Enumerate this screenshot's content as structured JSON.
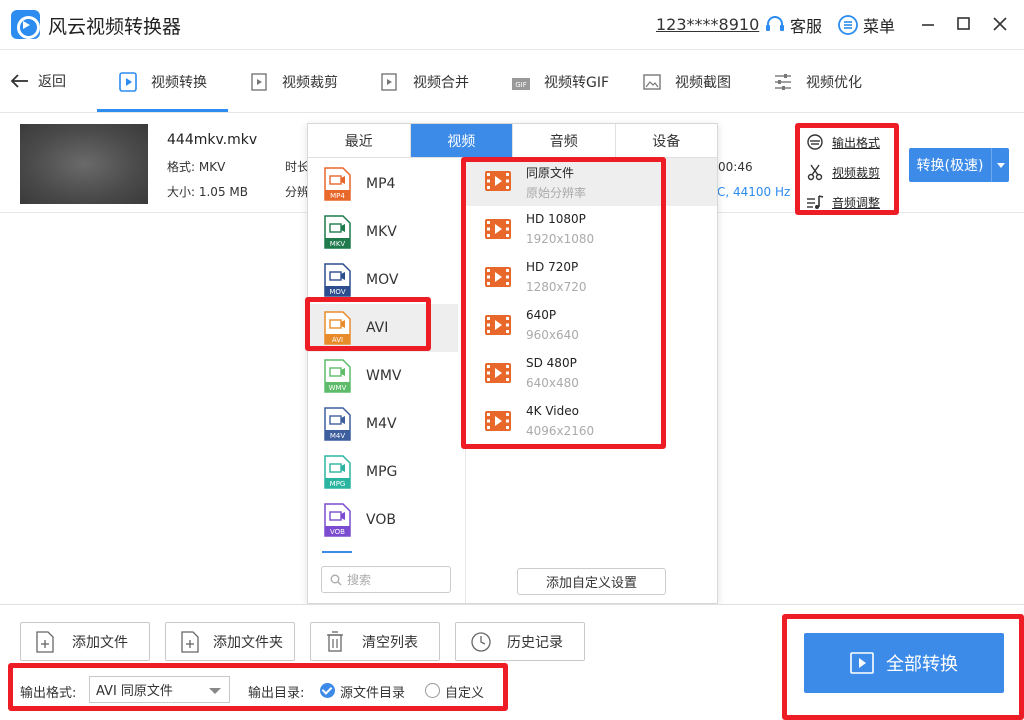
{
  "app": {
    "title": "风云视频转换器",
    "account": "123****8910",
    "service": "客服",
    "menu": "菜单"
  },
  "nav": {
    "back": "返回",
    "tabs": [
      "视频转换",
      "视频裁剪",
      "视频合并",
      "视频转GIF",
      "视频截图",
      "视频优化"
    ],
    "active_tab": "视频转换"
  },
  "file": {
    "name": "444mkv.mkv",
    "format": "格式: MKV",
    "size": "大小: 1.05 MB",
    "duration_label": "时长",
    "resolution_label": "分辨",
    "duration_partial": "00:46",
    "audio_partial": "C, 44100 Hz"
  },
  "side_links": {
    "output_format": "输出格式",
    "video_crop": "视频裁剪",
    "audio_adjust": "音频调整"
  },
  "convert_button": "转换(极速)",
  "popup": {
    "tabs": [
      "最近",
      "视频",
      "音频",
      "设备"
    ],
    "active_tab": "视频",
    "formats": [
      {
        "name": "MP4",
        "badge": "MP4",
        "color": "#e8672a"
      },
      {
        "name": "MKV",
        "badge": "MKV",
        "color": "#1f7a4c"
      },
      {
        "name": "MOV",
        "badge": "MOV",
        "color": "#2c4d8e"
      },
      {
        "name": "AVI",
        "badge": "AVI",
        "color": "#e88b2a"
      },
      {
        "name": "WMV",
        "badge": "WMV",
        "color": "#5dbb6a"
      },
      {
        "name": "M4V",
        "badge": "M4V",
        "color": "#3e5f9e"
      },
      {
        "name": "MPG",
        "badge": "MPG",
        "color": "#2bb5a0"
      },
      {
        "name": "VOB",
        "badge": "VOB",
        "color": "#7b4bd0"
      }
    ],
    "selected_format": "AVI",
    "resolutions": [
      {
        "name": "同原文件",
        "sub": "原始分辨率"
      },
      {
        "name": "HD 1080P",
        "sub": "1920x1080"
      },
      {
        "name": "HD 720P",
        "sub": "1280x720"
      },
      {
        "name": "640P",
        "sub": "960x640"
      },
      {
        "name": "SD 480P",
        "sub": "640x480"
      },
      {
        "name": "4K Video",
        "sub": "4096x2160"
      }
    ],
    "search_placeholder": "搜索",
    "add_custom": "添加自定义设置"
  },
  "bottom": {
    "add_file": "添加文件",
    "add_folder": "添加文件夹",
    "clear_list": "清空列表",
    "history": "历史记录",
    "output_format_label": "输出格式:",
    "output_format_value": "AVI 同原文件",
    "output_dir_label": "输出目录:",
    "dir_source": "源文件目录",
    "dir_custom": "自定义",
    "convert_all": "全部转换"
  },
  "colors": {
    "accent": "#3d8be8",
    "highlight": "#ee1c25"
  }
}
